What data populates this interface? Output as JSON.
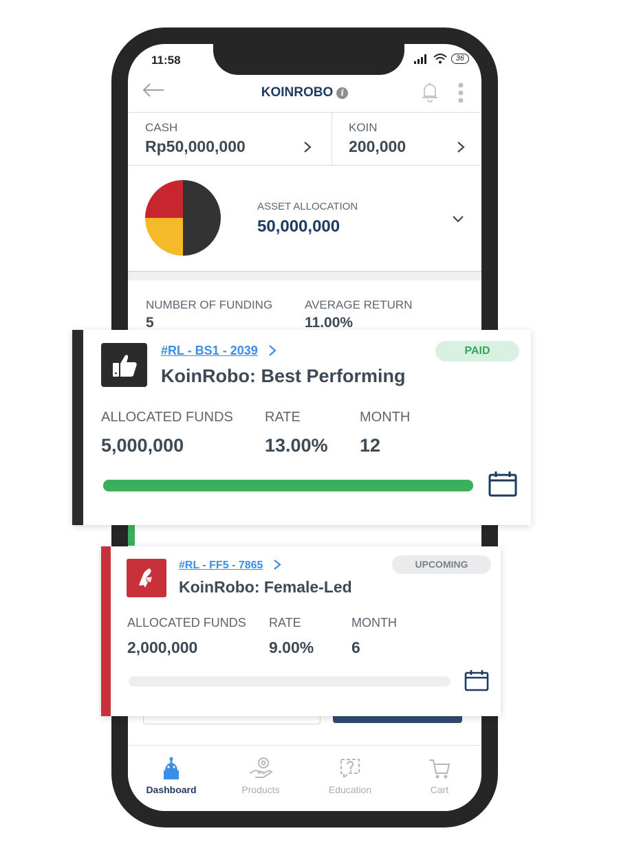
{
  "status": {
    "time": "11:58",
    "battery": "36"
  },
  "appbar": {
    "title": "KOINROBO"
  },
  "summary": {
    "cash_label": "CASH",
    "cash_value": "Rp50,000,000",
    "koin_label": "KOIN",
    "koin_value": "200,000"
  },
  "allocation": {
    "label": "ASSET ALLOCATION",
    "value": "50,000,000",
    "slices": [
      {
        "fraction": 0.5,
        "color": "#333333"
      },
      {
        "fraction": 0.25,
        "color": "#f5b92a"
      },
      {
        "fraction": 0.25,
        "color": "#c8262f"
      }
    ]
  },
  "stats": {
    "funding_label": "NUMBER OF FUNDING",
    "funding_value": "5",
    "return_label": "AVERAGE RETURN",
    "return_value": "11.00%"
  },
  "cards": [
    {
      "code": "#RL - BS1 - 2039",
      "title": "KoinRobo: Best Performing",
      "status": "PAID",
      "status_bg": "#d9f1e0",
      "status_color": "#3aa55a",
      "icon": "thumbs-up-icon",
      "icon_bg": "#2b2b2b",
      "bar_color": "#2b2b2b",
      "funds_label": "ALLOCATED FUNDS",
      "funds_value": "5,000,000",
      "rate_label": "RATE",
      "rate_value": "13.00%",
      "month_label": "MONTH",
      "month_value": "12",
      "progress": 1.0,
      "progress_color": "#3aaf5c"
    },
    {
      "code": "#RL - FF5 - 7865",
      "title": "KoinRobo: Female-Led",
      "status": "UPCOMING",
      "status_bg": "#e9ebed",
      "status_color": "#7a8187",
      "icon": "female-profile-icon",
      "icon_bg": "#c8303a",
      "bar_color": "#c8303a",
      "funds_label": "ALLOCATED FUNDS",
      "funds_value": "2,000,000",
      "rate_label": "RATE",
      "rate_value": "9.00%",
      "month_label": "MONTH",
      "month_value": "6",
      "progress": 0.0,
      "progress_color": "#3aaf5c"
    }
  ],
  "nav": [
    {
      "label": "Dashboard",
      "icon": "robot-icon",
      "active": true
    },
    {
      "label": "Products",
      "icon": "hand-coin-icon",
      "active": false
    },
    {
      "label": "Education",
      "icon": "question-bubble-icon",
      "active": false
    },
    {
      "label": "Cart",
      "icon": "cart-icon",
      "active": false
    }
  ]
}
